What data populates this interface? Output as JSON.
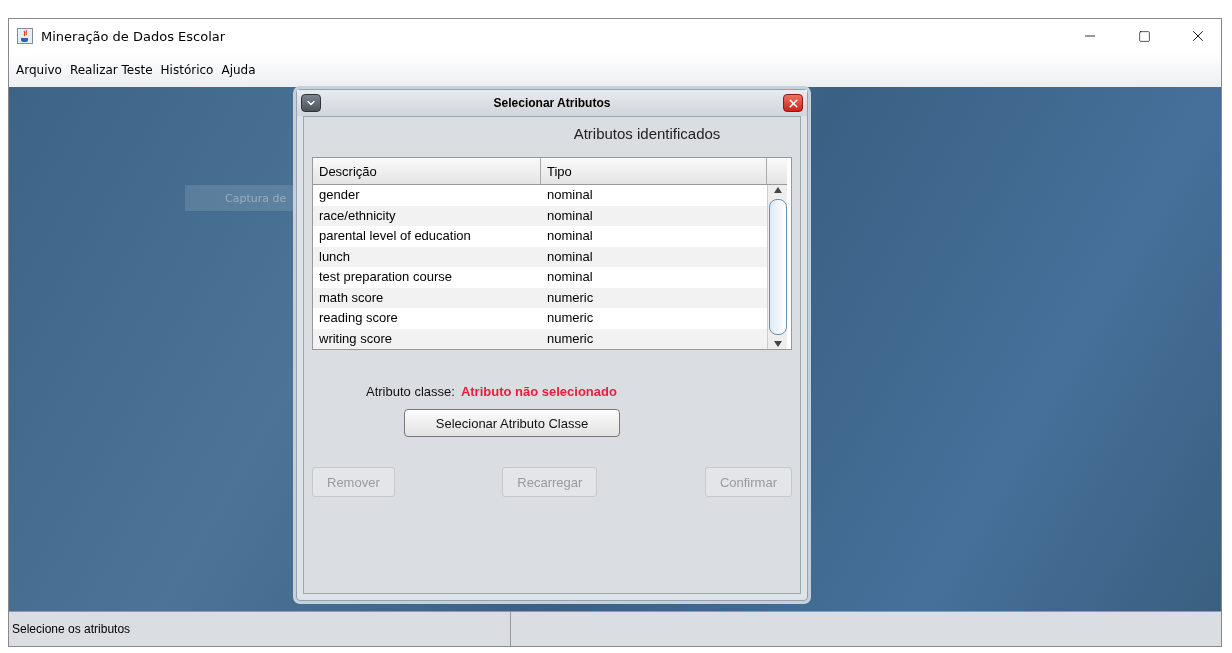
{
  "window": {
    "title": "Mineração de Dados Escolar"
  },
  "menu": [
    "Arquivo",
    "Realizar Teste",
    "Histórico",
    "Ajuda"
  ],
  "desktop": {
    "hidden_button": "Captura de"
  },
  "dialog": {
    "title": "Selecionar Atributos",
    "heading": "Atributos identificados",
    "table": {
      "columns": [
        "Descrição",
        "Tipo"
      ],
      "rows": [
        {
          "description": "gender",
          "type": "nominal"
        },
        {
          "description": "race/ethnicity",
          "type": "nominal"
        },
        {
          "description": "parental level of education",
          "type": "nominal"
        },
        {
          "description": "lunch",
          "type": "nominal"
        },
        {
          "description": "test preparation course",
          "type": "nominal"
        },
        {
          "description": "math score",
          "type": "numeric"
        },
        {
          "description": "reading score",
          "type": "numeric"
        },
        {
          "description": "writing score",
          "type": "numeric"
        }
      ]
    },
    "class_label": "Atributo classe:",
    "class_value": "Atributo não selecionado",
    "select_button": "Selecionar Atributo Classe",
    "buttons": [
      {
        "label": "Remover",
        "disabled": true
      },
      {
        "label": "Recarregar",
        "disabled": true
      },
      {
        "label": "Confirmar",
        "disabled": true
      }
    ]
  },
  "status_bar": [
    "Selecione os atributos"
  ]
}
